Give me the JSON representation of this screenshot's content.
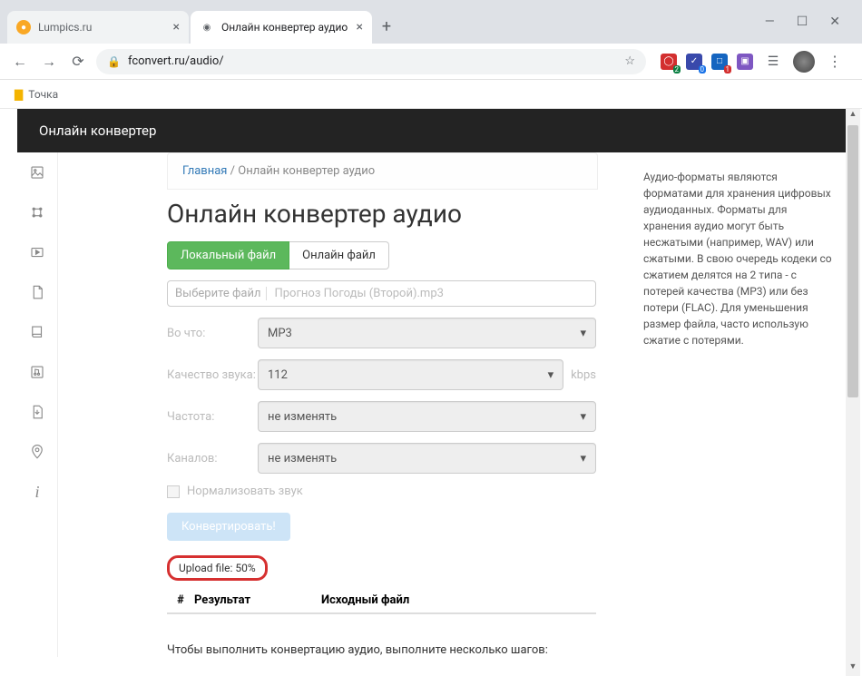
{
  "browser": {
    "tabs": [
      {
        "title": "Lumpics.ru",
        "active": false
      },
      {
        "title": "Онлайн конвертер аудио",
        "active": true
      }
    ],
    "url": "fconvert.ru/audio/",
    "bookmarks": [
      {
        "label": "Точка"
      }
    ],
    "window": {
      "min": "—",
      "max": "☐",
      "close": "✕"
    },
    "ext_badges": [
      "2",
      "0",
      "1"
    ]
  },
  "page": {
    "header_title": "Онлайн конвертер",
    "breadcrumb": {
      "home": "Главная",
      "sep": "/",
      "current": "Онлайн конвертер аудио"
    },
    "h1": "Онлайн конвертер аудио",
    "source_tabs": {
      "local": "Локальный файл",
      "online": "Онлайн файл"
    },
    "file": {
      "choose": "Выберите файл",
      "name": "Прогноз Погоды (Второй).mp3"
    },
    "fields": {
      "format": {
        "label": "Во что:",
        "value": "MP3"
      },
      "quality": {
        "label": "Качество звука:",
        "value": "112",
        "unit": "kbps"
      },
      "freq": {
        "label": "Частота:",
        "value": "не изменять"
      },
      "channels": {
        "label": "Каналов:",
        "value": "не изменять"
      },
      "normalize": "Нормализовать звук"
    },
    "convert_btn": "Конвертировать!",
    "upload": "Upload file: 50%",
    "table": {
      "hash": "#",
      "result": "Результат",
      "source": "Исходный файл"
    },
    "hint": "Чтобы выполнить конвертацию аудио, выполните несколько шагов:",
    "aside": "Аудио-форматы являются форматами для хранения цифровых аудиоданных. Форматы для хранения аудио могут быть несжатыми (например, WAV) или сжатыми. В свою очередь кодеки со сжатием делятся на 2 типа - с потерей качества (MP3) или без потери (FLAC). Для уменьшения размер файла, часто использую сжатие с потерями."
  }
}
